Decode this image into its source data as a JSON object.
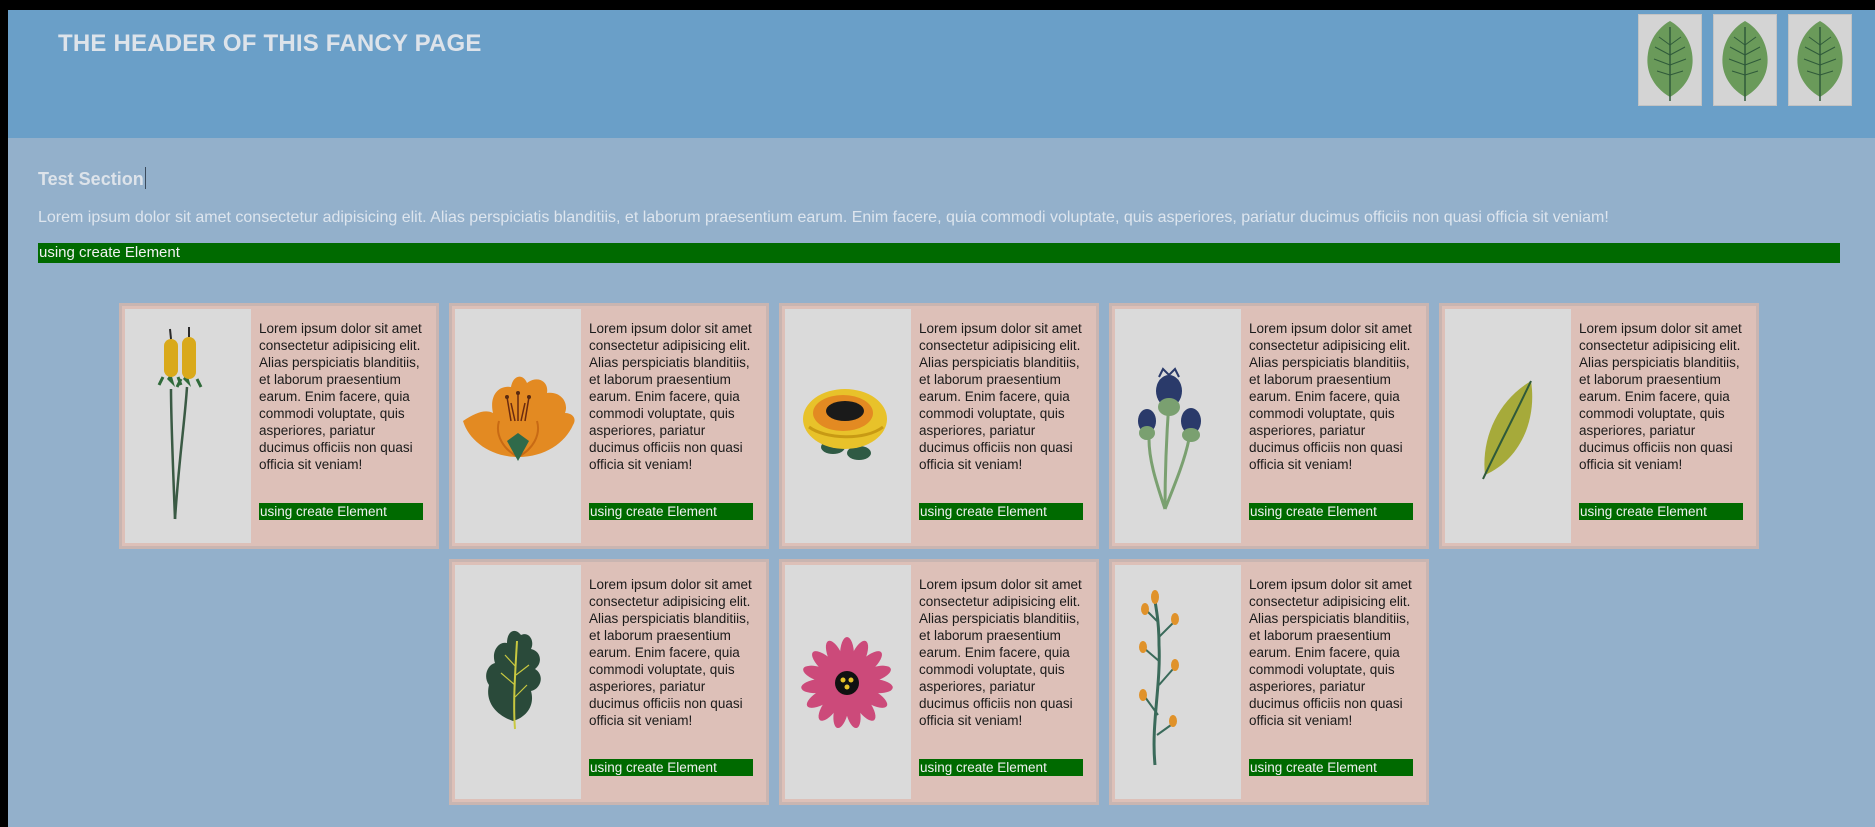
{
  "header": {
    "title": "THE HEADER OF THIS FANCY PAGE",
    "icons": [
      "leaf-icon",
      "leaf-icon",
      "leaf-icon"
    ]
  },
  "section": {
    "title": "Test Section",
    "text": "Lorem ipsum dolor sit amet consectetur adipisicing elit. Alias perspiciatis blanditiis, et laborum praesentium earum. Enim facere, quia commodi voluptate, quis asperiores, pariatur ducimus officiis non quasi officia sit veniam!",
    "bar_label": "using create Element"
  },
  "cards": [
    {
      "icon": "cattail-flower-icon",
      "text": "Lorem ipsum dolor sit amet consectetur adipisicing elit. Alias perspiciatis blanditiis, et laborum praesentium earum. Enim facere, quia commodi voluptate, quis asperiores, pariatur ducimus officiis non quasi officia sit veniam!",
      "button": "using create Element"
    },
    {
      "icon": "orange-flower-icon",
      "text": "Lorem ipsum dolor sit amet consectetur adipisicing elit. Alias perspiciatis blanditiis, et laborum praesentium earum. Enim facere, quia commodi voluptate, quis asperiores, pariatur ducimus officiis non quasi officia sit veniam!",
      "button": "using create Element"
    },
    {
      "icon": "yellow-rose-icon",
      "text": "Lorem ipsum dolor sit amet consectetur adipisicing elit. Alias perspiciatis blanditiis, et laborum praesentium earum. Enim facere, quia commodi voluptate, quis asperiores, pariatur ducimus officiis non quasi officia sit veniam!",
      "button": "using create Element"
    },
    {
      "icon": "thistle-icon",
      "text": "Lorem ipsum dolor sit amet consectetur adipisicing elit. Alias perspiciatis blanditiis, et laborum praesentium earum. Enim facere, quia commodi voluptate, quis asperiores, pariatur ducimus officiis non quasi officia sit veniam!",
      "button": "using create Element"
    },
    {
      "icon": "olive-leaf-icon",
      "text": "Lorem ipsum dolor sit amet consectetur adipisicing elit. Alias perspiciatis blanditiis, et laborum praesentium earum. Enim facere, quia commodi voluptate, quis asperiores, pariatur ducimus officiis non quasi officia sit veniam!",
      "button": "using create Element"
    },
    {
      "icon": "oak-leaf-icon",
      "text": "Lorem ipsum dolor sit amet consectetur adipisicing elit. Alias perspiciatis blanditiis, et laborum praesentium earum. Enim facere, quia commodi voluptate, quis asperiores, pariatur ducimus officiis non quasi officia sit veniam!",
      "button": "using create Element"
    },
    {
      "icon": "pink-daisy-icon",
      "text": "Lorem ipsum dolor sit amet consectetur adipisicing elit. Alias perspiciatis blanditiis, et laborum praesentium earum. Enim facere, quia commodi voluptate, quis asperiores, pariatur ducimus officiis non quasi officia sit veniam!",
      "button": "using create Element"
    },
    {
      "icon": "berry-branch-icon",
      "text": "Lorem ipsum dolor sit amet consectetur adipisicing elit. Alias perspiciatis blanditiis, et laborum praesentium earum. Enim facere, quia commodi voluptate, quis asperiores, pariatur ducimus officiis non quasi officia sit veniam!",
      "button": "using create Element"
    }
  ],
  "colors": {
    "header_bg": "#6a9fc8",
    "page_bg": "#93b0cb",
    "card_bg": "#ddc0b8",
    "button_green": "#006a00"
  }
}
